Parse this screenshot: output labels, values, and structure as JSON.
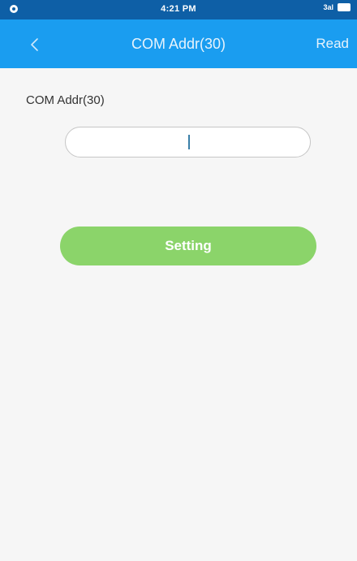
{
  "status_bar": {
    "time": "4:21 PM",
    "signal_label": "3al",
    "battery_icon": "battery-icon"
  },
  "nav": {
    "back_icon": "chevron-left-icon",
    "title": "COM Addr(30)",
    "read_label": "Read"
  },
  "form": {
    "field_label": "COM Addr(30)",
    "input_value": "",
    "input_placeholder": ""
  },
  "actions": {
    "setting_label": "Setting"
  },
  "colors": {
    "status_bar": "#0e5fa6",
    "nav_bar": "#1a9df0",
    "setting_button": "#8bd46a",
    "background": "#f6f6f6"
  }
}
